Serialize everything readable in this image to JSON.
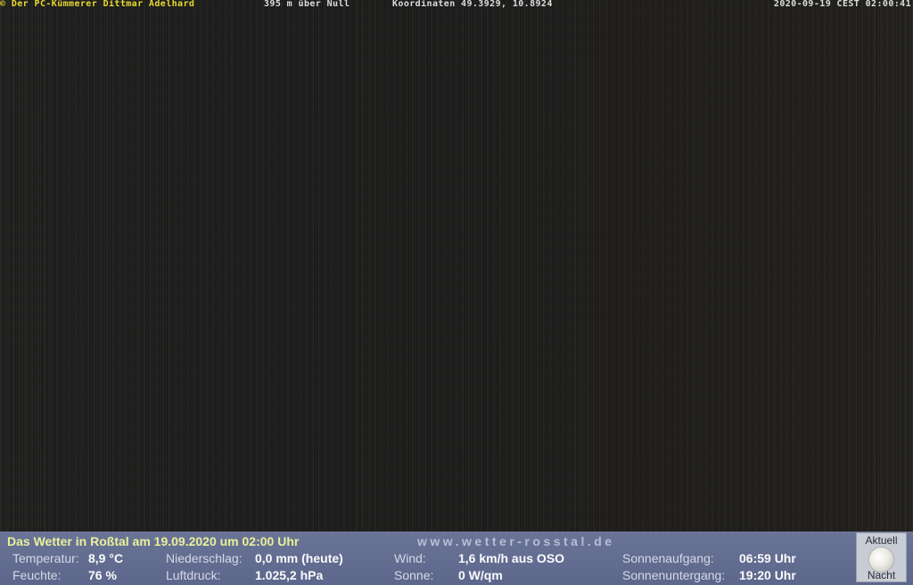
{
  "overlay": {
    "copyright": "© Der PC-Kümmerer Dittmar Adelhard",
    "altitude": "395 m über Null",
    "coordinates": "Koordinaten 49.3929, 10.8924",
    "timestamp": "2020-09-19 CEST 02:00:41"
  },
  "weather": {
    "title": "Das Wetter in Roßtal am 19.09.2020 um 02:00 Uhr",
    "website": "www.wetter-rosstal.de",
    "temperature": {
      "label": "Temperatur:",
      "value": "8,9 °C"
    },
    "humidity": {
      "label": "Feuchte:",
      "value": "76 %"
    },
    "precipitation": {
      "label": "Niederschlag:",
      "value": "0,0 mm (heute)"
    },
    "pressure": {
      "label": "Luftdruck:",
      "value": "1.025,2 hPa"
    },
    "wind": {
      "label": "Wind:",
      "value": "1,6 km/h aus OSO"
    },
    "sun": {
      "label": "Sonne:",
      "value": "0 W/qm"
    },
    "sunrise": {
      "label": "Sonnenaufgang:",
      "value": "06:59 Uhr"
    },
    "sunset": {
      "label": "Sonnenuntergang:",
      "value": "19:20 Uhr"
    },
    "moon": {
      "top_label": "Aktuell",
      "bottom_label": "Nacht",
      "icon": "moon-icon"
    }
  },
  "colors": {
    "title": "#e9f09a",
    "copyright": "#e8d830",
    "panel_background": "#6a7496"
  }
}
